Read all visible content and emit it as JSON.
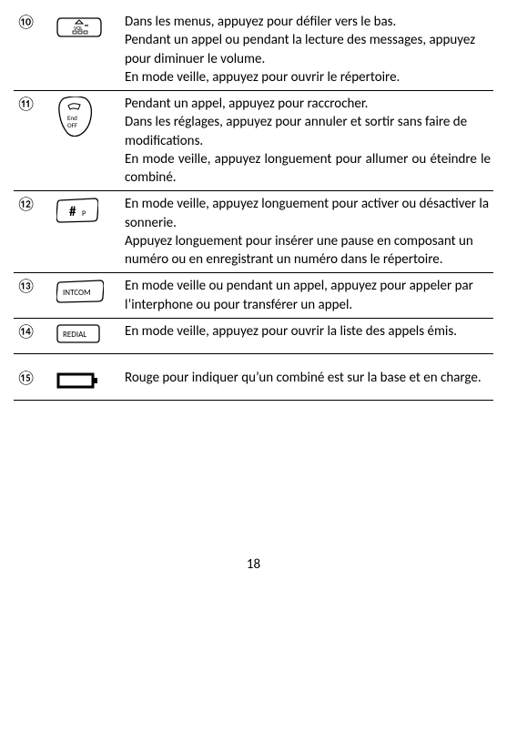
{
  "rows": [
    {
      "num": "⑩",
      "desc": "Dans les menus, appuyez pour défiler vers le bas.\nPendant un appel ou pendant la lecture des messages, appuyez pour diminuer le volume.\nEn mode veille, appuyez pour ouvrir le répertoire."
    },
    {
      "num": "⑪",
      "desc": "Pendant un appel, appuyez pour raccrocher.\nDans les réglages, appuyez pour annuler et sortir sans faire de modifications.\nEn mode veille, appuyez longuement pour allumer ou éteindre le combiné."
    },
    {
      "num": "⑫",
      "desc": "En mode veille, appuyez longuement pour activer ou désactiver la sonnerie.\nAppuyez longuement pour insérer une pause en composant un numéro ou en enregistrant un numéro dans le répertoire."
    },
    {
      "num": "⑬",
      "desc": "En mode veille ou pendant un appel, appuyez pour appeler par l’interphone ou pour transférer un appel."
    },
    {
      "num": "⑭",
      "desc": "En mode veille, appuyez pour ouvrir la liste des appels émis."
    },
    {
      "num": "⑮",
      "desc": "Rouge pour indiquer qu’un combiné est sur la base et en charge."
    }
  ],
  "page": "18",
  "labels": {
    "end": "End",
    "off": "OFF",
    "vol": "VOL",
    "intcom": "INTCOM",
    "redial": "REDIAL"
  }
}
